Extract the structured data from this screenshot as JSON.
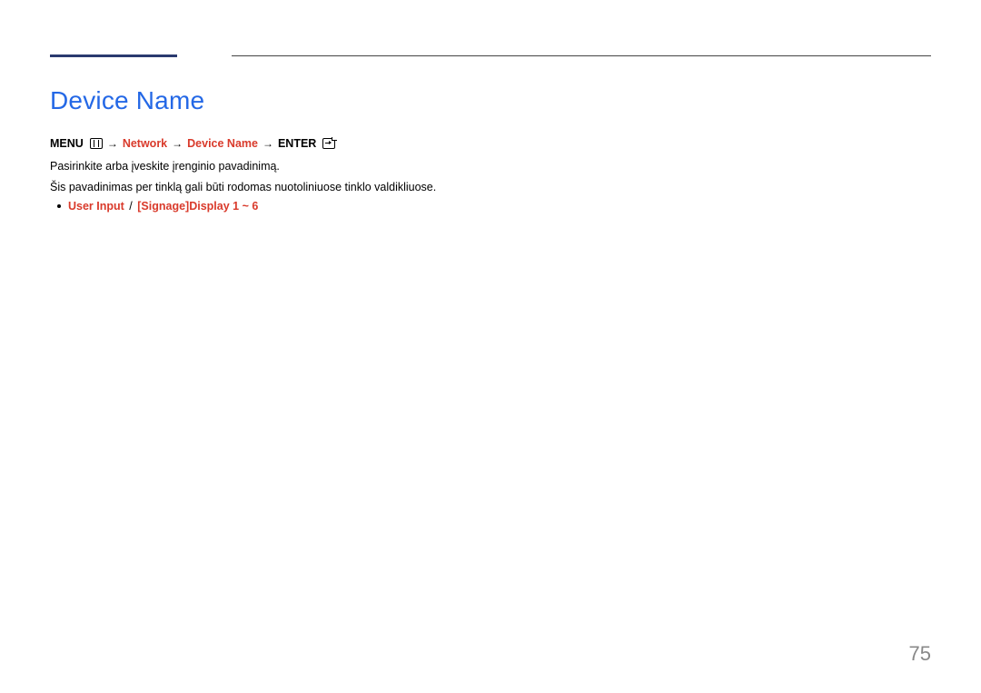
{
  "title": "Device Name",
  "nav": {
    "menu_label": "MENU",
    "network": "Network",
    "device_name": "Device Name",
    "enter_label": "ENTER"
  },
  "body": {
    "line1": "Pasirinkite arba įveskite įrenginio pavadinimą.",
    "line2": "Šis pavadinimas per tinklą gali būti rodomas nuotoliniuose tinklo valdikliuose."
  },
  "options": {
    "user_input": "User Input",
    "separator": "/",
    "signage": "[Signage]Display 1 ~ 6"
  },
  "page_number": "75"
}
